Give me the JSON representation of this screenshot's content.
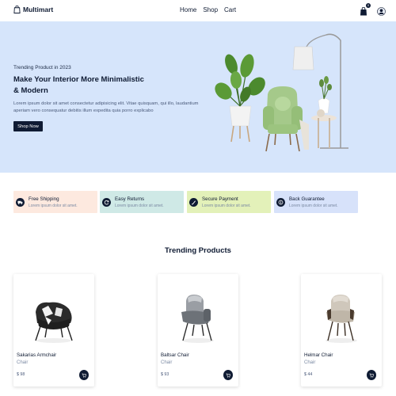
{
  "header": {
    "logo_text": "Multimart",
    "nav": [
      "Home",
      "Shop",
      "Cart"
    ],
    "cart_count": "0"
  },
  "hero": {
    "subtitle": "Trending Product in 2023",
    "title": "Make Your Interior More Minimalistic & Modern",
    "text": "Lorem ipsum dolor sit amet consectetur adipisicing elit. Vitae quisquam, qui illo, laudantium aperiam vero consequatur debitis illum expedita quia porro explicabo",
    "button": "Shop Now"
  },
  "services": [
    {
      "title": "Free Shipping",
      "subtitle": "Lorem ipsum dolor sit amet.",
      "color": "#fde9df",
      "icon": "truck-icon"
    },
    {
      "title": "Easy Returns",
      "subtitle": "Lorem ipsum dolor sit amet.",
      "color": "#cfe9e6",
      "icon": "refresh-icon"
    },
    {
      "title": "Secure Payment",
      "subtitle": "Lorem ipsum dolor sit amet.",
      "color": "#e3f1b9",
      "icon": "card-icon"
    },
    {
      "title": "Back Guarantee",
      "subtitle": "Lorem ipsum dolor sit amet.",
      "color": "#d7e2fa",
      "icon": "money-icon"
    }
  ],
  "trending": {
    "title": "Trending Products",
    "products": [
      {
        "name": "Sakarias Armchair",
        "category": "Chair",
        "price": "$ 98"
      },
      {
        "name": "Baltsar Chair",
        "category": "Chair",
        "price": "$ 93"
      },
      {
        "name": "Helmar Chair",
        "category": "Chair",
        "price": "$ 44"
      }
    ]
  },
  "colors": {
    "primary": "#0f1b33",
    "hero_bg": "#d6e5fb"
  }
}
